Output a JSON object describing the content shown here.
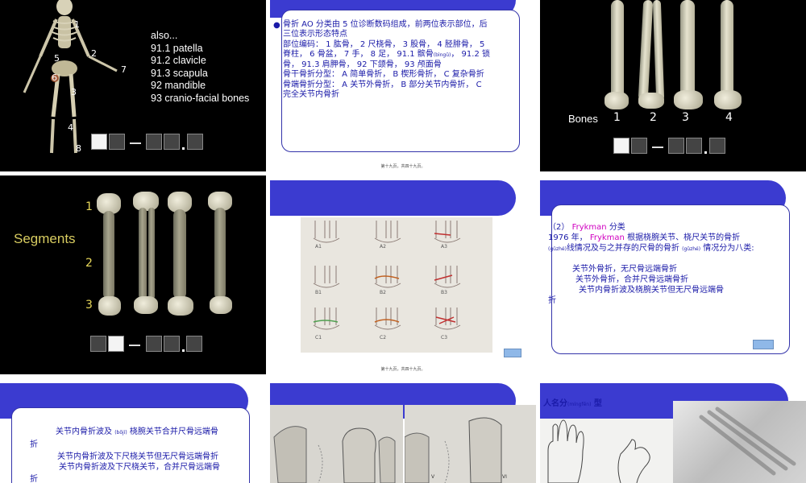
{
  "slide1": {
    "labels": [
      "1",
      "2",
      "5",
      "6",
      "7",
      "3",
      "4",
      "8"
    ],
    "list_title": "also...",
    "list": [
      "91.1 patella",
      "91.2 clavicle",
      "91.3 scapula",
      "92 mandible",
      "93 cranio-facial bones"
    ]
  },
  "slide2": {
    "bullet": "●",
    "lines": [
      "骨折 AO 分类由 5 位诊断数码组成，前两位表示部位，后",
      "三位表示形态特点",
      "部位编码： 1 肱骨， 2 尺桡骨， 3 股骨， 4 胫腓骨， 5",
      "脊柱， 6 骨盆， 7 手， 8 足， 91.1 髌骨",
      "骨， 91.3 肩胛骨， 92 下颌骨， 93 颅面骨",
      "骨干骨折分型： A 简单骨折， B 楔形骨折， C 复杂骨折",
      "骨端骨折分型： A 关节外骨折， B 部分关节内骨折， C",
      "完全关节内骨折"
    ],
    "ruby_bingu": "(bìngǔ)",
    "line4_tail": "， 91.2 锁",
    "footer": "第十九页，共四十九页。"
  },
  "slide3": {
    "bones_label": "Bones",
    "numbers": [
      "1",
      "2",
      "3",
      "4"
    ]
  },
  "slide4": {
    "segments_label": "Segments",
    "numbers": [
      "1",
      "2",
      "3"
    ]
  },
  "slide5": {
    "sketch_labels": [
      "A1",
      "A2",
      "A3",
      "B1",
      "B2",
      "B3",
      "C1",
      "C2",
      "C3"
    ],
    "footer": "第十九页，共四十九页。"
  },
  "slide6": {
    "line1_prefix": "（2）",
    "line1_name": "Frykman",
    "line1_suffix": "分类",
    "line2_prefix": "1976 年，",
    "line2_name": "Frykman",
    "line2_suffix": "根据桡腕关节、桡尺关节的骨折",
    "ruby_guzhe": "(gǔzhé)",
    "line3": "线情况及与之并存的尺骨的骨折",
    "line3_tail": "情况分为八类:",
    "items": [
      "关节外骨折，无尺骨远端骨折",
      "关节外骨折，合并尺骨远端骨折",
      "关节内骨折波及桡腕关节但无尺骨远端骨"
    ],
    "item_tail": "折"
  },
  "slide7": {
    "lines": [
      "关节内骨折波及",
      "桡腕关节合并尺骨远端骨",
      "折",
      "关节内骨折波及下尺桡关节但无尺骨远端骨折",
      "关节内骨折波及下尺桡关节，合并尺骨远端骨",
      "折"
    ],
    "ruby_boji": "(bōjí)"
  },
  "slide8": {
    "labels": [
      "V",
      "VI"
    ]
  },
  "slide9": {
    "title": "人名分",
    "ruby": "(míngfēn)",
    "title_tail": "型"
  },
  "colors": {
    "banner": "#3b3bd0",
    "text_blue": "#1a1aa8",
    "frykman_pink": "#d000c0",
    "slide_dark": "#000000"
  }
}
